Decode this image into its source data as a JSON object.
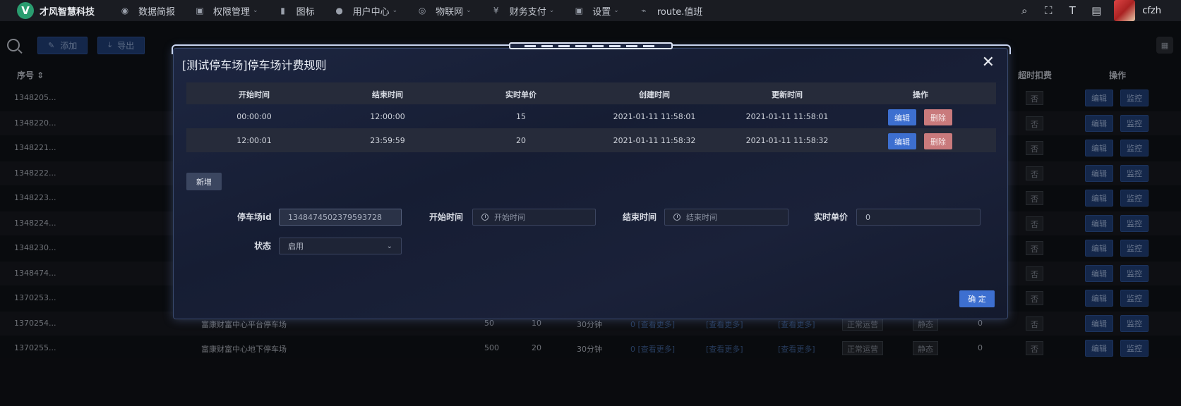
{
  "topbar": {
    "logo_mark": "V",
    "logo_text": "才风智慧科技",
    "nav": [
      {
        "icon": "dashboard-icon",
        "glyph": "◉",
        "label": "数据简报",
        "caret": false
      },
      {
        "icon": "lock-icon",
        "glyph": "▣",
        "label": "权限管理",
        "caret": true
      },
      {
        "icon": "info-icon",
        "glyph": "▮",
        "label": "图标",
        "caret": false
      },
      {
        "icon": "users-icon",
        "glyph": "●",
        "label": "用户中心",
        "caret": true
      },
      {
        "icon": "iot-icon",
        "glyph": "◎",
        "label": "物联网",
        "caret": true
      },
      {
        "icon": "yen-icon",
        "glyph": "¥",
        "label": "财务支付",
        "caret": true
      },
      {
        "icon": "lock-icon",
        "glyph": "▣",
        "label": "设置",
        "caret": true
      },
      {
        "icon": "route-icon",
        "glyph": "⌁",
        "label": "route.值班",
        "caret": false
      }
    ],
    "username": "cfzh"
  },
  "toolbar": {
    "add_label": "添加",
    "export_label": "导出"
  },
  "bg_table": {
    "headers": {
      "id": "序号",
      "overtime": "超时扣费",
      "actions": "操作"
    },
    "rows": [
      {
        "id": "1348205...",
        "name": "",
        "a": "",
        "b": "",
        "c": "",
        "more": false,
        "tags": false,
        "num": "",
        "flag": "否"
      },
      {
        "id": "1348220...",
        "name": "",
        "a": "",
        "b": "",
        "c": "",
        "more": false,
        "tags": false,
        "num": "",
        "flag": "否"
      },
      {
        "id": "1348221...",
        "name": "",
        "a": "",
        "b": "",
        "c": "",
        "more": false,
        "tags": false,
        "num": "",
        "flag": "否"
      },
      {
        "id": "1348222...",
        "name": "",
        "a": "",
        "b": "",
        "c": "",
        "more": false,
        "tags": false,
        "num": "",
        "flag": "否"
      },
      {
        "id": "1348223...",
        "name": "",
        "a": "",
        "b": "",
        "c": "",
        "more": false,
        "tags": false,
        "num": "",
        "flag": "否"
      },
      {
        "id": "1348224...",
        "name": "",
        "a": "",
        "b": "",
        "c": "",
        "more": false,
        "tags": false,
        "num": "",
        "flag": "否"
      },
      {
        "id": "1348230...",
        "name": "",
        "a": "",
        "b": "",
        "c": "",
        "more": false,
        "tags": false,
        "num": "",
        "flag": "否"
      },
      {
        "id": "1348474...",
        "name": "",
        "a": "",
        "b": "",
        "c": "",
        "more": false,
        "tags": false,
        "num": "",
        "flag": "否"
      },
      {
        "id": "1370253...",
        "name": "",
        "a": "",
        "b": "",
        "c": "",
        "more": false,
        "tags": false,
        "num": "",
        "flag": "否"
      },
      {
        "id": "1370254...",
        "name": "富康财富中心平台停车场",
        "a": "50",
        "b": "10",
        "c": "30分钟",
        "more": true,
        "tags": true,
        "num": "0",
        "flag": "否"
      },
      {
        "id": "1370255...",
        "name": "富康财富中心地下停车场",
        "a": "500",
        "b": "20",
        "c": "30分钟",
        "more": true,
        "tags": true,
        "num": "0",
        "flag": "否"
      }
    ],
    "more_first": "0 [查看更多]",
    "more_label": "[查看更多]",
    "status_tag": "正常运营",
    "static_tag": "静态",
    "edit_label": "编辑",
    "monitor_label": "监控"
  },
  "modal": {
    "title": "[测试停车场]停车场计费规则",
    "table": {
      "headers": [
        "开始时间",
        "结束时间",
        "实时单价",
        "创建时间",
        "更新时间",
        "操作"
      ],
      "rows": [
        [
          "00:00:00",
          "12:00:00",
          "15",
          "2021-01-11 11:58:01",
          "2021-01-11 11:58:01"
        ],
        [
          "12:00:01",
          "23:59:59",
          "20",
          "2021-01-11 11:58:32",
          "2021-01-11 11:58:32"
        ]
      ],
      "edit_label": "编辑",
      "delete_label": "删除"
    },
    "add_label": "新增",
    "form": {
      "lot_id_label": "停车场id",
      "lot_id_value": "1348474502379593728",
      "start_label": "开始时间",
      "start_placeholder": "开始时间",
      "end_label": "结束时间",
      "end_placeholder": "结束时间",
      "price_label": "实时单价",
      "price_value": "0",
      "status_label": "状态",
      "status_value": "启用"
    },
    "ok_label": "确 定"
  }
}
